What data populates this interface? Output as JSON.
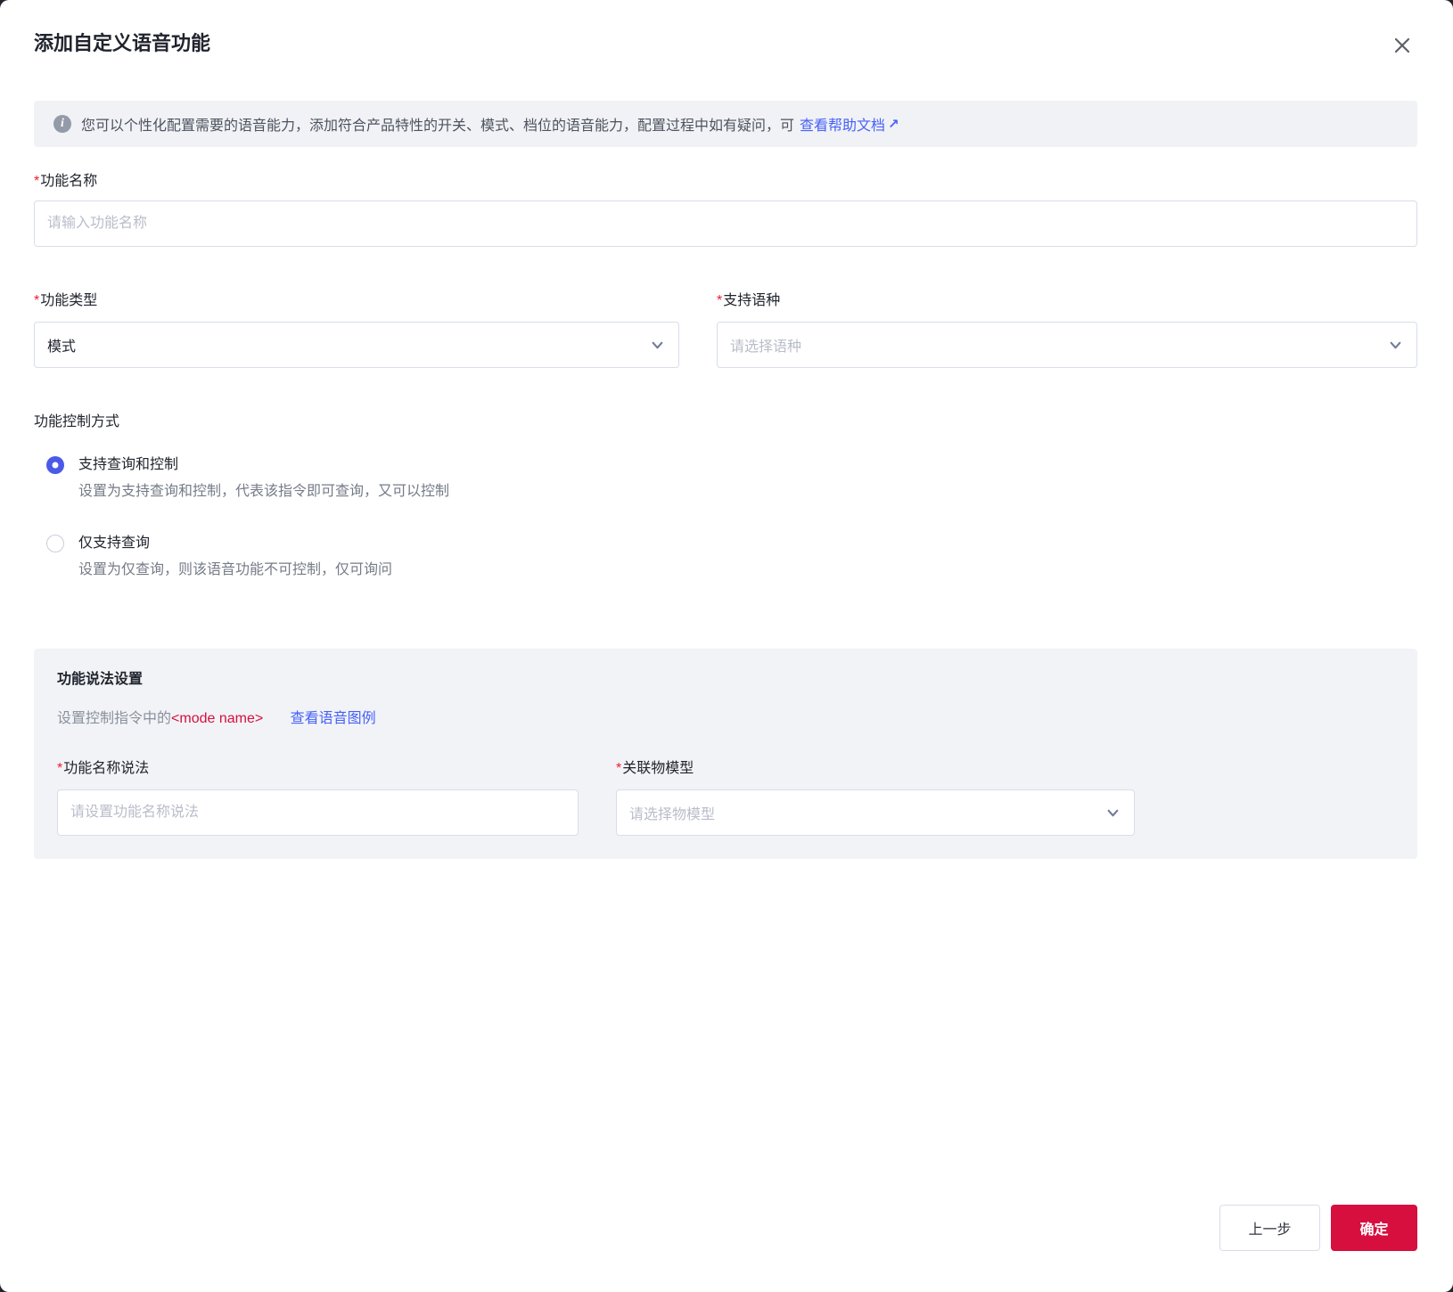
{
  "required_mark": "*",
  "dialog": {
    "title": "添加自定义语音功能"
  },
  "banner": {
    "icon_glyph": "i",
    "text": "您可以个性化配置需要的语音能力，添加符合产品特性的开关、模式、档位的语音能力，配置过程中如有疑问，可",
    "link": "查看帮助文档",
    "arrow": "↗"
  },
  "fields": {
    "function_name": {
      "label": "功能名称",
      "placeholder": "请输入功能名称"
    },
    "function_type": {
      "label": "功能类型",
      "value": "模式"
    },
    "language": {
      "label": "支持语种",
      "placeholder": "请选择语种"
    }
  },
  "control_mode": {
    "label": "功能控制方式",
    "options": [
      {
        "label": "支持查询和控制",
        "description": "设置为支持查询和控制，代表该指令即可查询，又可以控制",
        "selected": true
      },
      {
        "label": "仅支持查询",
        "description": "设置为仅查询，则该语音功能不可控制，仅可询问",
        "selected": false
      }
    ]
  },
  "statement_panel": {
    "title": "功能说法设置",
    "subtitle_prefix": "设置控制指令中的",
    "subtitle_highlight": "<mode name>",
    "subtitle_link": "查看语音图例",
    "fields": {
      "name_statement": {
        "label": "功能名称说法",
        "placeholder": "请设置功能名称说法"
      },
      "thing_model": {
        "label": "关联物模型",
        "placeholder": "请选择物模型"
      }
    }
  },
  "footer": {
    "prev_label": "上一步",
    "confirm_label": "确定"
  },
  "colors": {
    "accent_link": "#4661f6",
    "radio_selected": "#4a5ae8",
    "danger": "#d60f3e",
    "required": "#ee1c2e",
    "panel_bg": "#f2f3f7",
    "banner_bg": "#f1f2f6",
    "border": "#d8dde8",
    "placeholder": "#b9bdc9",
    "text_primary": "#20242d",
    "text_secondary": "#757b87"
  }
}
